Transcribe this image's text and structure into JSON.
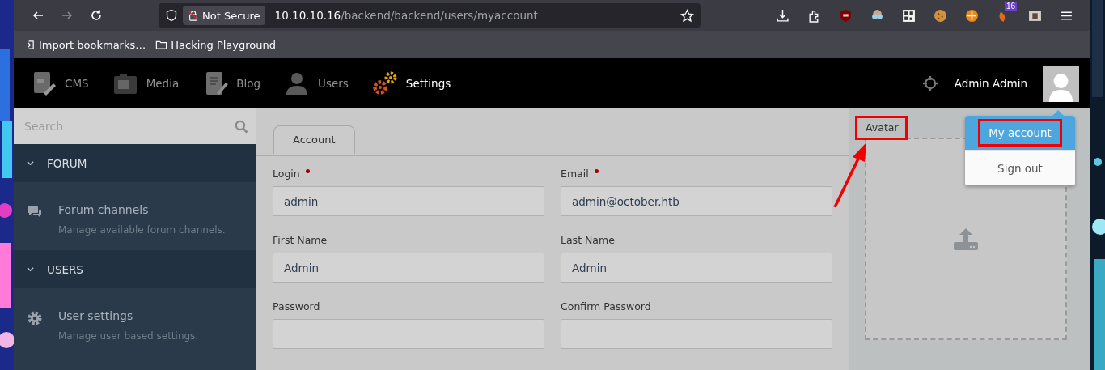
{
  "browser": {
    "nav_buttons": [
      {
        "kind": "back",
        "disabled": false
      },
      {
        "kind": "forward",
        "disabled": true
      },
      {
        "kind": "reload",
        "disabled": false
      }
    ],
    "security_label": "Not Secure",
    "url_host": "10.10.10.16",
    "url_path": "/backend/backend/users/myaccount",
    "toolbar_icons": [
      {
        "kind": "download"
      },
      {
        "kind": "puzzle"
      },
      {
        "kind": "shield"
      },
      {
        "kind": "glasses"
      },
      {
        "kind": "qr"
      },
      {
        "kind": "cookie"
      },
      {
        "kind": "orange-disc"
      },
      {
        "kind": "leaf",
        "badge": "16"
      },
      {
        "kind": "frame"
      },
      {
        "kind": "menu"
      }
    ],
    "bookmarks": [
      {
        "kind": "import",
        "label": "Import bookmarks…"
      },
      {
        "kind": "folder",
        "label": "Hacking Playground"
      }
    ]
  },
  "navbar": {
    "items": [
      {
        "kind": "cms",
        "label": "CMS",
        "selected": false
      },
      {
        "kind": "media",
        "label": "Media",
        "selected": false
      },
      {
        "kind": "blog",
        "label": "Blog",
        "selected": false
      },
      {
        "kind": "users",
        "label": "Users",
        "selected": false
      },
      {
        "kind": "settings",
        "label": "Settings",
        "selected": true
      }
    ],
    "user_name": "Admin Admin"
  },
  "sidebar": {
    "search": {
      "placeholder": "Search"
    },
    "sections": [
      {
        "title": "FORUM",
        "expanded": true,
        "items": [
          {
            "kind": "chat",
            "label": "Forum channels",
            "description": "Manage available forum channels."
          }
        ]
      },
      {
        "title": "USERS",
        "expanded": true,
        "items": [
          {
            "kind": "gear",
            "label": "User settings",
            "description": "Manage user based settings."
          }
        ]
      }
    ]
  },
  "tabs": [
    {
      "label": "Account",
      "selected": true
    }
  ],
  "fields": [
    {
      "label": "Login",
      "required": true,
      "value": "admin"
    },
    {
      "label": "Email",
      "required": true,
      "value": "admin@october.htb"
    },
    {
      "label": "First Name",
      "required": false,
      "value": "Admin"
    },
    {
      "label": "Last Name",
      "required": false,
      "value": "Admin"
    },
    {
      "label": "Password",
      "required": false
    },
    {
      "label": "Confirm Password",
      "required": false
    }
  ],
  "avatar": {
    "label": "Avatar",
    "highlighted": true,
    "arrow": true
  },
  "user_menu": {
    "items": [
      {
        "label": "My account",
        "selected": true,
        "highlighted": true
      },
      {
        "label": "Sign out",
        "selected": false,
        "highlighted": false
      }
    ]
  }
}
